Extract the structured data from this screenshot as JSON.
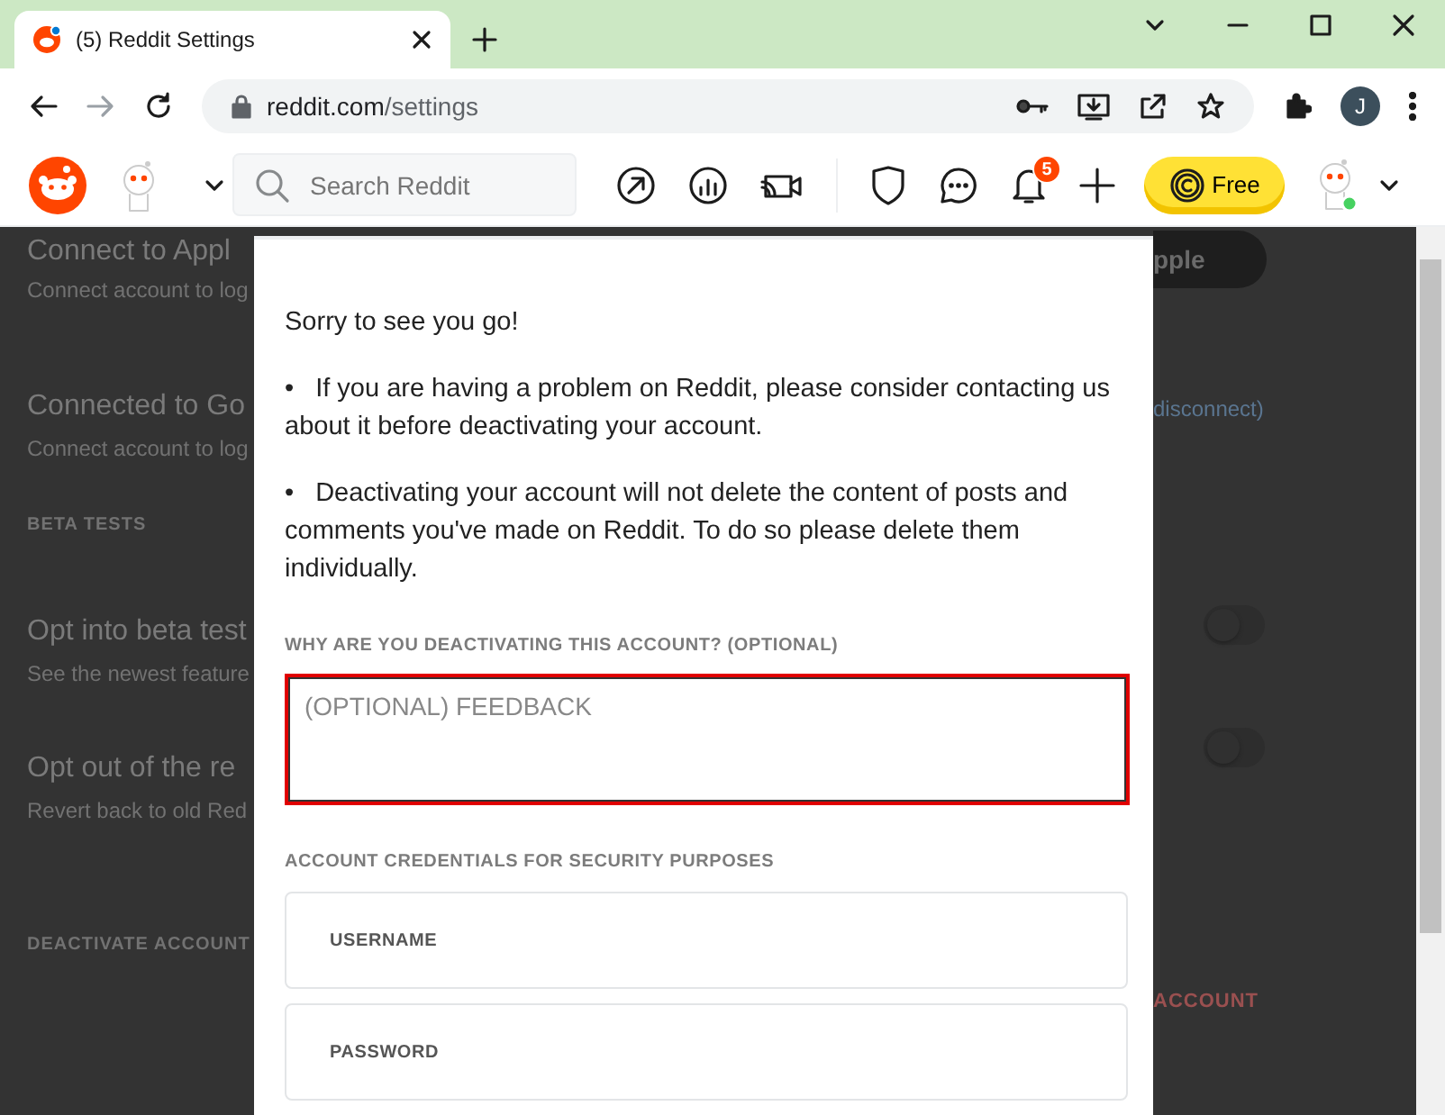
{
  "browser": {
    "tabs": [
      {
        "title": "(5) Reddit Settings",
        "selected": true
      }
    ],
    "url_host": "reddit.com",
    "url_path": "/settings",
    "profile_initial": "J"
  },
  "header": {
    "search": {
      "placeholder": "Search Reddit"
    },
    "notification_count": "5",
    "premium_button": "Free"
  },
  "background": {
    "left": [
      {
        "kind": "title",
        "text": "Connect to Appl"
      },
      {
        "kind": "desc",
        "text": "Connect account to log"
      },
      {
        "kind": "title",
        "text": "Connected to Go"
      },
      {
        "kind": "desc",
        "text": "Connect account to log"
      },
      {
        "kind": "section",
        "text": "BETA TESTS"
      },
      {
        "kind": "title",
        "text": "Opt into beta test"
      },
      {
        "kind": "desc",
        "text": "See the newest feature"
      },
      {
        "kind": "title",
        "text": "Opt out of the re"
      },
      {
        "kind": "desc",
        "text": "Revert back to old Red"
      },
      {
        "kind": "section",
        "text": "DEACTIVATE ACCOUNT"
      }
    ],
    "right": [
      {
        "kind": "button",
        "text": "pple"
      },
      {
        "kind": "link",
        "text": "disconnect)"
      },
      {
        "kind": "toggle",
        "on": false
      },
      {
        "kind": "toggle",
        "on": false
      },
      {
        "kind": "danger",
        "text": "ACCOUNT"
      }
    ]
  },
  "modal": {
    "intro": "Sorry to see you go!",
    "bullets": [
      {
        "marker": "•",
        "text": "If you are having a problem on Reddit, please consider contacting us about it before deactivating your account."
      },
      {
        "marker": "•",
        "text": "Deactivating your account will not delete the content of posts and comments you've made on Reddit. To do so please delete them individually."
      }
    ],
    "feedback_label": "WHY ARE YOU DEACTIVATING THIS ACCOUNT? (OPTIONAL)",
    "feedback": {
      "placeholder": "(OPTIONAL) FEEDBACK",
      "highlighted": true
    },
    "credentials_label": "ACCOUNT CREDENTIALS FOR SECURITY PURPOSES",
    "fields": [
      {
        "placeholder": "USERNAME"
      },
      {
        "placeholder": "PASSWORD"
      }
    ]
  }
}
